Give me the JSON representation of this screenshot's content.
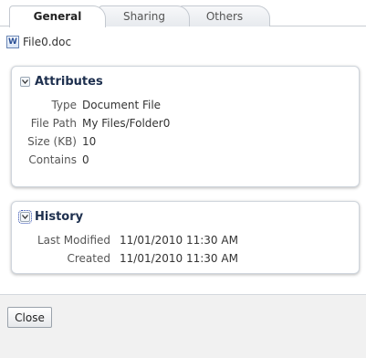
{
  "tabs": [
    {
      "label": "General",
      "active": true
    },
    {
      "label": "Sharing",
      "active": false
    },
    {
      "label": "Others",
      "active": false
    }
  ],
  "file": {
    "icon": "word-document-icon",
    "icon_letter": "W",
    "name": "File0.doc"
  },
  "attributes": {
    "title": "Attributes",
    "rows": [
      {
        "label": "Type",
        "value": "Document File"
      },
      {
        "label": "File Path",
        "value": "My Files/Folder0"
      },
      {
        "label": "Size (KB)",
        "value": "10"
      },
      {
        "label": "Contains",
        "value": "0"
      }
    ]
  },
  "history": {
    "title": "History",
    "rows": [
      {
        "label": "Last Modified",
        "value": "11/01/2010 11:30 AM"
      },
      {
        "label": "Created",
        "value": "11/01/2010 11:30 AM"
      }
    ]
  },
  "footer": {
    "close_label": "Close"
  }
}
